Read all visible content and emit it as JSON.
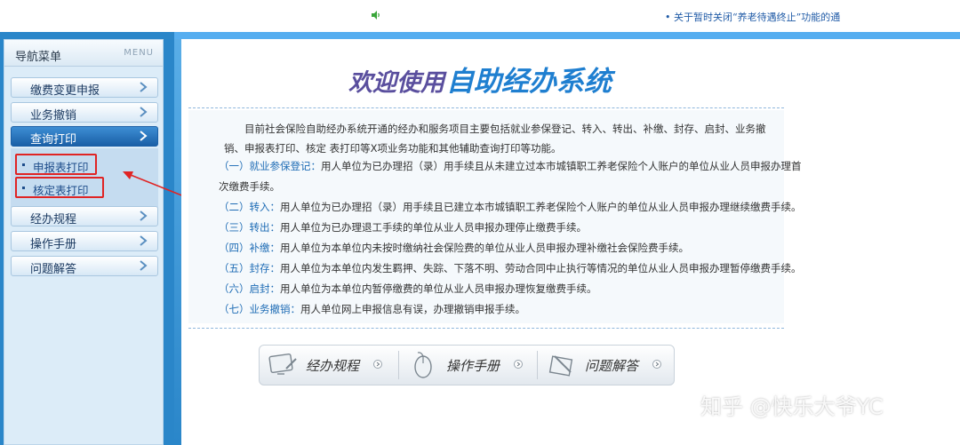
{
  "topbar": {
    "notice": "• 关于暂时关闭“养老待遇终止”功能的通"
  },
  "sidebar": {
    "title": "导航菜单",
    "menu_tag": "MENU",
    "items": [
      {
        "label": "缴费变更申报"
      },
      {
        "label": "业务撤销"
      },
      {
        "label": "查询打印"
      },
      {
        "label": "经办规程"
      },
      {
        "label": "操作手册"
      },
      {
        "label": "问题解答"
      }
    ],
    "subitems": [
      {
        "label": "申报表打印"
      },
      {
        "label": "核定表打印"
      }
    ]
  },
  "main": {
    "welcome_part1": "欢迎使用",
    "welcome_part2": "自助经办系统",
    "intro_paragraph": "目前社会保险自助经办系统开通的经办和服务项目主要包括就业参保登记、转入、转出、补缴、封存、启封、业务撤销、申报表打印、核定 表打印等X项业务功能和其他辅助查询打印等功能。",
    "items": [
      {
        "tag": "（一）就业参保登记：",
        "text": "用人单位为已办理招（录）用手续且从未建立过本市城镇职工养老保险个人账户的单位从业人员申报办理首"
      },
      {
        "tag": "",
        "text": "次缴费手续。"
      },
      {
        "tag": "（二）转入：",
        "text": "用人单位为已办理招（录）用手续且已建立本市城镇职工养老保险个人账户的单位从业人员申报办理继续缴费手续。"
      },
      {
        "tag": "（三）转出：",
        "text": "用人单位为已办理退工手续的单位从业人员申报办理停止缴费手续。"
      },
      {
        "tag": "（四）补缴：",
        "text": "用人单位为本单位内未按时缴纳社会保险费的单位从业人员申报办理补缴社会保险费手续。"
      },
      {
        "tag": "（五）封存：",
        "text": "用人单位为本单位内发生羁押、失踪、下落不明、劳动合同中止执行等情况的单位从业人员申报办理暂停缴费手续。"
      },
      {
        "tag": "（六）启封：",
        "text": "用人单位为本单位内暂停缴费的单位从业人员申报办理恢复缴费手续。"
      },
      {
        "tag": "（七）业务撤销：",
        "text": "用人单位网上申报信息有误，办理撤销申报手续。"
      }
    ],
    "buttons": [
      {
        "label": "经办规程"
      },
      {
        "label": "操作手册"
      },
      {
        "label": "问题解答"
      }
    ]
  },
  "watermark": "知乎 @快乐大爷YC",
  "colors": {
    "frame_blue": "#2a86c9",
    "active_menu": "#1a5fa6",
    "highlight_red": "#e02424",
    "tag_blue": "#1e6cb5"
  }
}
